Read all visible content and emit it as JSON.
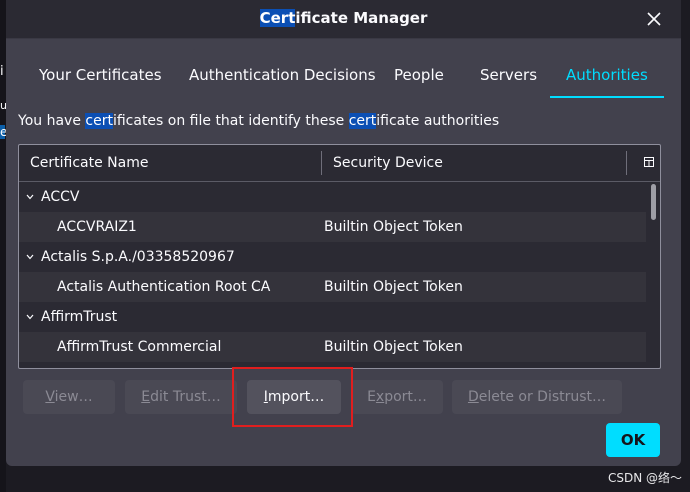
{
  "window": {
    "title_highlight": "Cert",
    "title_rest": "ificate Manager",
    "close_icon": "close-icon"
  },
  "tabs": [
    {
      "label": "Your Certificates",
      "active": false
    },
    {
      "label": "Authentication Decisions",
      "active": false
    },
    {
      "label": "People",
      "active": false
    },
    {
      "label": "Servers",
      "active": false
    },
    {
      "label": "Authorities",
      "active": true
    }
  ],
  "description": {
    "part1": "You have ",
    "hl1": "cert",
    "part2": "ificates on file that identify these ",
    "hl2": "cert",
    "part3": "ificate authorities"
  },
  "table": {
    "columns": [
      "Certificate Name",
      "Security Device"
    ],
    "column_picker_icon": "column-picker-icon",
    "rows": [
      {
        "type": "group",
        "name": "ACCV",
        "device": ""
      },
      {
        "type": "cert",
        "name": "ACCVRAIZ1",
        "device": "Builtin Object Token"
      },
      {
        "type": "group",
        "name": "Actalis S.p.A./03358520967",
        "device": ""
      },
      {
        "type": "cert",
        "name": "Actalis Authentication Root CA",
        "device": "Builtin Object Token"
      },
      {
        "type": "group",
        "name": "AffirmTrust",
        "device": ""
      },
      {
        "type": "cert",
        "name": "AffirmTrust Commercial",
        "device": "Builtin Object Token"
      }
    ]
  },
  "buttons": {
    "view": {
      "accel": "V",
      "rest": "iew…"
    },
    "edit_trust": {
      "accel": "E",
      "rest": "dit Trust…"
    },
    "import": {
      "accel": "I",
      "rest": "mport…"
    },
    "export": {
      "pre": "E",
      "accel": "x",
      "rest": "port…"
    },
    "delete": {
      "accel": "D",
      "rest": "elete or Distrust…"
    },
    "ok": "OK"
  },
  "watermark": "CSDN @络～",
  "background_glyphs": [
    "i",
    "u",
    "e"
  ],
  "colors": {
    "accent": "#00ddff",
    "dialog_bg": "#42414d",
    "titlebar_bg": "#2b2a33",
    "highlight": "#0b4fb4",
    "annotation_box": "#e01e1e"
  }
}
